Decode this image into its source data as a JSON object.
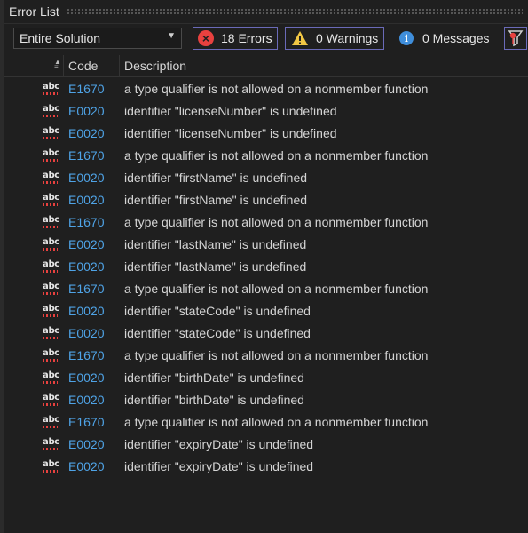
{
  "window": {
    "title": "Error List"
  },
  "toolbar": {
    "scope_value": "Entire Solution",
    "errors_label": "18 Errors",
    "warnings_label": "0 Warnings",
    "messages_label": "0 Messages"
  },
  "columns": {
    "code": "Code",
    "description": "Description"
  },
  "rows": [
    {
      "icon": "abc",
      "code": "E1670",
      "description": "a type qualifier is not allowed on a nonmember function"
    },
    {
      "icon": "abc",
      "code": "E0020",
      "description": "identifier \"licenseNumber\" is undefined"
    },
    {
      "icon": "abc",
      "code": "E0020",
      "description": "identifier \"licenseNumber\" is undefined"
    },
    {
      "icon": "abc",
      "code": "E1670",
      "description": "a type qualifier is not allowed on a nonmember function"
    },
    {
      "icon": "abc",
      "code": "E0020",
      "description": "identifier \"firstName\" is undefined"
    },
    {
      "icon": "abc",
      "code": "E0020",
      "description": "identifier \"firstName\" is undefined"
    },
    {
      "icon": "abc",
      "code": "E1670",
      "description": "a type qualifier is not allowed on a nonmember function"
    },
    {
      "icon": "abc",
      "code": "E0020",
      "description": "identifier \"lastName\" is undefined"
    },
    {
      "icon": "abc",
      "code": "E0020",
      "description": "identifier \"lastName\" is undefined"
    },
    {
      "icon": "abc",
      "code": "E1670",
      "description": "a type qualifier is not allowed on a nonmember function"
    },
    {
      "icon": "abc",
      "code": "E0020",
      "description": "identifier \"stateCode\" is undefined"
    },
    {
      "icon": "abc",
      "code": "E0020",
      "description": "identifier \"stateCode\" is undefined"
    },
    {
      "icon": "abc",
      "code": "E1670",
      "description": "a type qualifier is not allowed on a nonmember function"
    },
    {
      "icon": "abc",
      "code": "E0020",
      "description": "identifier \"birthDate\" is undefined"
    },
    {
      "icon": "abc",
      "code": "E0020",
      "description": "identifier \"birthDate\" is undefined"
    },
    {
      "icon": "abc",
      "code": "E1670",
      "description": "a type qualifier is not allowed on a nonmember function"
    },
    {
      "icon": "abc",
      "code": "E0020",
      "description": "identifier \"expiryDate\" is undefined"
    },
    {
      "icon": "abc",
      "code": "E0020",
      "description": "identifier \"expiryDate\" is undefined"
    }
  ],
  "colors": {
    "background": "#1f1f1f",
    "code_link": "#4fa3e6",
    "error_red": "#e8413f",
    "warning_yellow": "#f2c744",
    "info_blue": "#3f8edb",
    "filter_border": "#6a6ab8"
  },
  "icons": {
    "errors": "error-circle-icon",
    "warnings": "warning-triangle-icon",
    "messages": "info-circle-icon",
    "filter": "filter-icon",
    "row": "spelling-abc-icon"
  }
}
